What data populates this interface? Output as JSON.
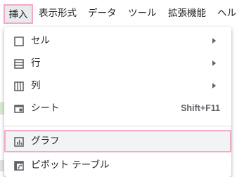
{
  "menubar": {
    "items": [
      {
        "label": "挿入",
        "active": true
      },
      {
        "label": "表示形式"
      },
      {
        "label": "データ"
      },
      {
        "label": "ツール"
      },
      {
        "label": "拡張機能"
      },
      {
        "label": "ヘル"
      }
    ]
  },
  "dropdown": {
    "items": [
      {
        "label": "セル",
        "icon": "cell-icon",
        "submenu": true
      },
      {
        "label": "行",
        "icon": "row-icon",
        "submenu": true
      },
      {
        "label": "列",
        "icon": "column-icon",
        "submenu": true
      },
      {
        "label": "シート",
        "icon": "sheet-icon",
        "shortcut": "Shift+F11"
      },
      {
        "label": "グラフ",
        "icon": "chart-icon",
        "highlighted": true
      },
      {
        "label": "ピボット テーブル",
        "icon": "pivot-table-icon"
      }
    ]
  },
  "colors": {
    "highlight_border": "#f3a9c8",
    "icon": "#5f6368",
    "text": "#202124"
  }
}
